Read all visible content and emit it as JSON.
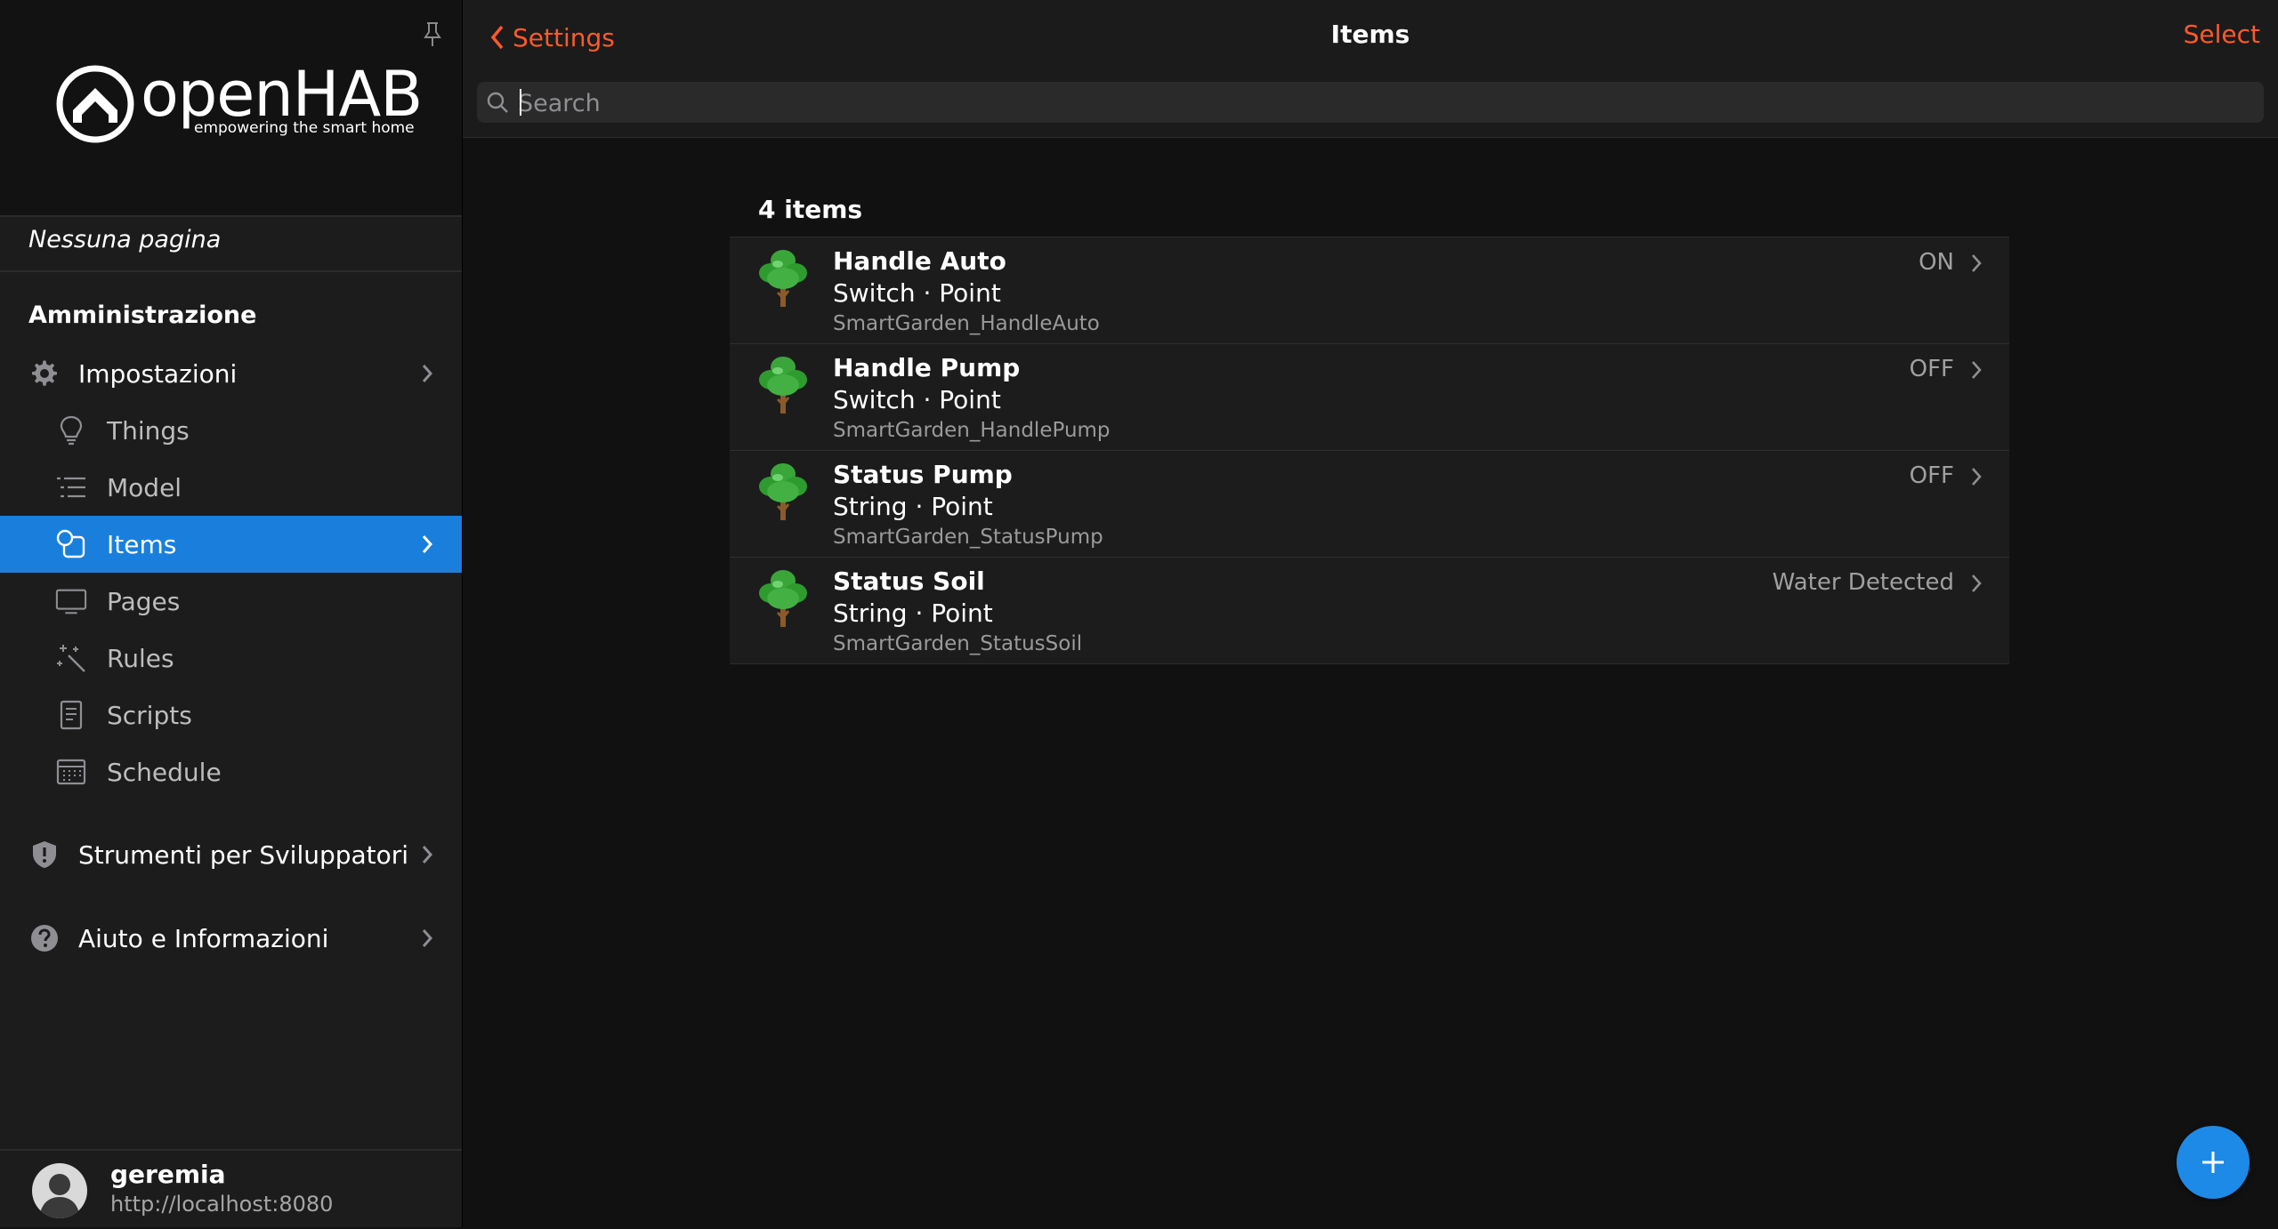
{
  "sidebar": {
    "logo_text": "openHAB",
    "logo_tagline": "empowering the smart home",
    "no_page": "Nessuna pagina",
    "section_title": "Amministrazione",
    "settings": {
      "label": "Impostazioni",
      "icon": "gear-icon"
    },
    "sub_items": [
      {
        "label": "Things",
        "icon": "lightbulb-icon"
      },
      {
        "label": "Model",
        "icon": "list-tree-icon"
      },
      {
        "label": "Items",
        "icon": "items-icon",
        "active": true
      },
      {
        "label": "Pages",
        "icon": "monitor-icon"
      },
      {
        "label": "Rules",
        "icon": "magic-wand-icon"
      },
      {
        "label": "Scripts",
        "icon": "document-icon"
      },
      {
        "label": "Schedule",
        "icon": "calendar-icon"
      }
    ],
    "developer_tools": {
      "label": "Strumenti per Sviluppatori",
      "icon": "shield-exclamation-icon"
    },
    "help": {
      "label": "Aiuto e Informazioni",
      "icon": "question-circle-icon"
    },
    "user": {
      "name": "geremia",
      "url": "http://localhost:8080"
    }
  },
  "navbar": {
    "back_label": "Settings",
    "title": "Items",
    "select_label": "Select"
  },
  "search": {
    "placeholder": "Search",
    "value": ""
  },
  "list": {
    "count_label": "4 items",
    "items": [
      {
        "label": "Handle Auto",
        "type": "Switch · Point",
        "name": "SmartGarden_HandleAuto",
        "state": "ON",
        "icon": "tree-icon"
      },
      {
        "label": "Handle Pump",
        "type": "Switch · Point",
        "name": "SmartGarden_HandlePump",
        "state": "OFF",
        "icon": "tree-icon"
      },
      {
        "label": "Status Pump",
        "type": "String · Point",
        "name": "SmartGarden_StatusPump",
        "state": "OFF",
        "icon": "tree-icon"
      },
      {
        "label": "Status Soil",
        "type": "String · Point",
        "name": "SmartGarden_StatusSoil",
        "state": "Water Detected",
        "icon": "tree-icon"
      }
    ]
  },
  "colors": {
    "accent": "#ff5a2a",
    "active_nav": "#1a7fdc",
    "fab": "#1e8ae8"
  }
}
